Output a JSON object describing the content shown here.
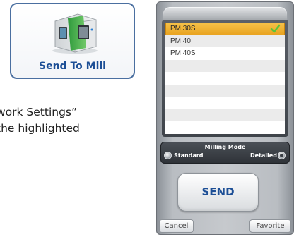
{
  "send_to_mill": {
    "label": "Send To Mill",
    "icon": "milling-machine-icon"
  },
  "doc": {
    "line1": "work Settings”",
    "line2": "the highlighted"
  },
  "device": {
    "materials": [
      {
        "label": "PM 30S",
        "selected": true
      },
      {
        "label": "PM 40",
        "selected": false
      },
      {
        "label": "PM 40S",
        "selected": false
      }
    ],
    "milling_mode": {
      "title": "Milling Mode",
      "standard_label": "Standard",
      "detailed_label": "Detailed",
      "selected": "Detailed"
    },
    "send_label": "SEND",
    "cancel_label": "Cancel",
    "favorite_label": "Favorite"
  },
  "colors": {
    "selection": "#f0b232",
    "check": "#5cc43a",
    "accent_blue": "#1d4f96"
  }
}
